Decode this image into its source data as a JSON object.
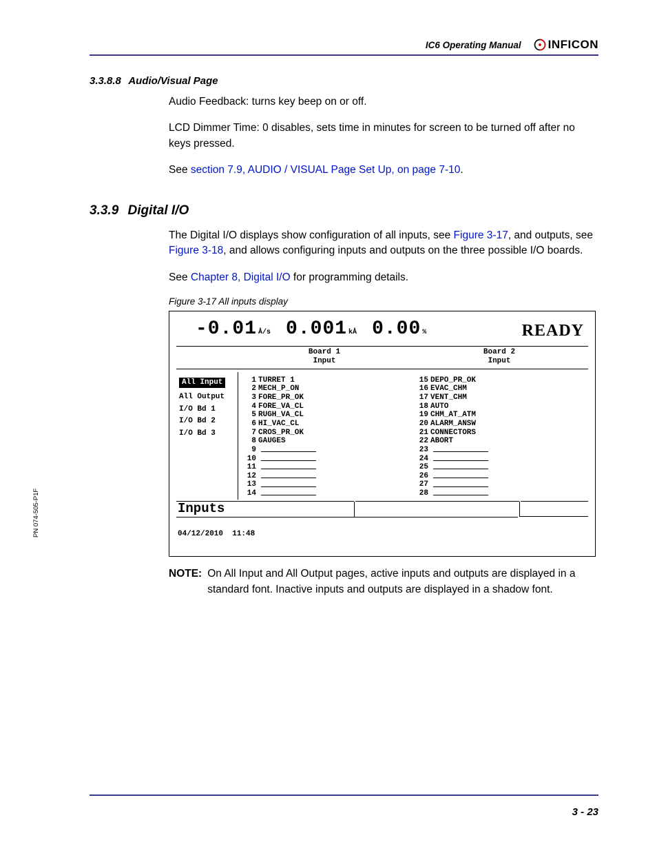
{
  "header": {
    "manual_title": "IC6 Operating Manual",
    "logo_text": "INFICON"
  },
  "side_pn": "PN 074-505-P1F",
  "sec_3388": {
    "num": "3.3.8.8",
    "title": "Audio/Visual Page",
    "p1": "Audio Feedback: turns key beep on or off.",
    "p2": "LCD Dimmer Time: 0 disables, sets time in minutes for screen to be turned off after no keys pressed.",
    "p3_pre": "See ",
    "p3_link": "section 7.9, AUDIO / VISUAL Page Set Up, on page 7-10",
    "p3_post": "."
  },
  "sec_339": {
    "num": "3.3.9",
    "title": "Digital I/O",
    "p1_a": "The Digital I/O displays show configuration of all inputs, see ",
    "p1_link1": "Figure 3-17",
    "p1_b": ", and outputs, see ",
    "p1_link2": "Figure 3-18",
    "p1_c": ", and allows configuring inputs and outputs on the three possible I/O boards.",
    "p2_a": "See ",
    "p2_link": "Chapter 8, Digital I/O",
    "p2_b": " for programming details."
  },
  "figure": {
    "caption": "Figure 3-17  All inputs display"
  },
  "screen": {
    "rate": "-0.01",
    "rate_unit": "Å/s",
    "thick": "0.001",
    "thick_unit": "kÅ",
    "pct": "0.00",
    "pct_unit": "%",
    "status": "READY",
    "board1_h1": "Board 1",
    "board1_h2": "Input",
    "board2_h1": "Board 2",
    "board2_h2": "Input",
    "sidebar": [
      "All Input",
      "All Output",
      "I/O Bd 1",
      "I/O Bd 2",
      "I/O Bd 3"
    ],
    "col1": [
      {
        "n": "1",
        "t": "TURRET 1"
      },
      {
        "n": "2",
        "t": "MECH_P_ON"
      },
      {
        "n": "3",
        "t": "FORE_PR_OK"
      },
      {
        "n": "4",
        "t": "FORE_VA_CL"
      },
      {
        "n": "5",
        "t": "RUGH_VA_CL"
      },
      {
        "n": "6",
        "t": "HI_VAC_CL"
      },
      {
        "n": "7",
        "t": "CROS_PR_OK"
      },
      {
        "n": "8",
        "t": "GAUGES"
      },
      {
        "n": "9",
        "t": ""
      },
      {
        "n": "10",
        "t": ""
      },
      {
        "n": "11",
        "t": ""
      },
      {
        "n": "12",
        "t": ""
      },
      {
        "n": "13",
        "t": ""
      },
      {
        "n": "14",
        "t": ""
      }
    ],
    "col2": [
      {
        "n": "15",
        "t": "DEPO_PR_OK"
      },
      {
        "n": "16",
        "t": "EVAC_CHM"
      },
      {
        "n": "17",
        "t": "VENT_CHM"
      },
      {
        "n": "18",
        "t": "AUTO"
      },
      {
        "n": "19",
        "t": "CHM_AT_ATM"
      },
      {
        "n": "20",
        "t": "ALARM_ANSW"
      },
      {
        "n": "21",
        "t": "CONNECTORS"
      },
      {
        "n": "22",
        "t": "ABORT"
      },
      {
        "n": "23",
        "t": ""
      },
      {
        "n": "24",
        "t": ""
      },
      {
        "n": "25",
        "t": ""
      },
      {
        "n": "26",
        "t": ""
      },
      {
        "n": "27",
        "t": ""
      },
      {
        "n": "28",
        "t": ""
      }
    ],
    "inputs_label": "Inputs",
    "date": "04/12/2010",
    "time": "11:48"
  },
  "note": {
    "label": "NOTE:",
    "text": "On All Input and All Output pages, active inputs and outputs are displayed in a standard font. Inactive inputs and outputs are displayed in a shadow font."
  },
  "page_num": "3 - 23"
}
